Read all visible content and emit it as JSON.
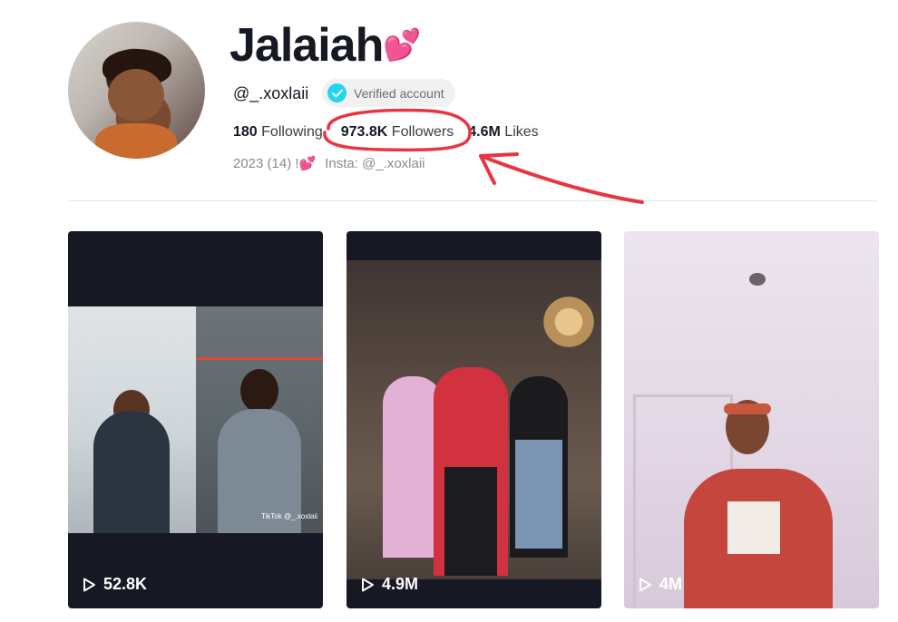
{
  "profile": {
    "name": "Jalaiah",
    "name_emoji": "💕",
    "handle": "@_.xoxlaii",
    "verified_label": "Verified account",
    "stats": {
      "following_count": "180",
      "following_label": "Following",
      "followers_count": "973.8K",
      "followers_label": "Followers",
      "likes_count": "4.6M",
      "likes_label": "Likes"
    },
    "bio_part1": "2023 (14) !💕",
    "bio_part2": "Insta: @_.xoxlaii"
  },
  "videos": [
    {
      "views": "52.8K",
      "watermark": "TikTok @_.xoxlaii"
    },
    {
      "views": "4.9M"
    },
    {
      "views": "4M"
    }
  ],
  "colors": {
    "annotation": "#e8353f",
    "verified_badge": "#20d5ec",
    "card_bg": "#161823"
  },
  "icons": [
    "verified-check-icon",
    "play-icon"
  ]
}
